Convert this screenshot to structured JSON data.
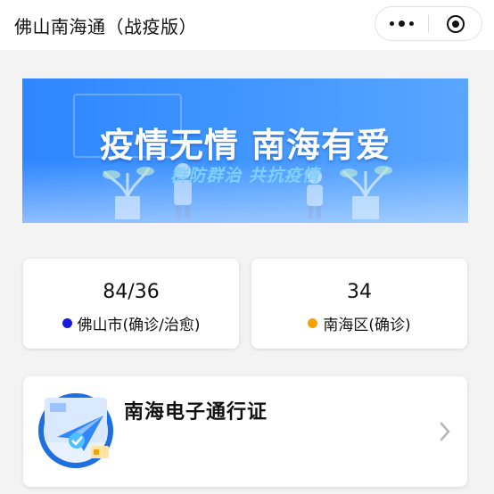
{
  "nav": {
    "title": "佛山南海通（战疫版）",
    "more_icon": "more-dots-icon",
    "close_icon": "target-icon"
  },
  "banner": {
    "title": "疫情无情 南海有爱",
    "subtitle": "群防群治 共抗疫情"
  },
  "stats": [
    {
      "value": "84/36",
      "label": "佛山市(确诊/治愈)",
      "dot_color": "#1a1adf"
    },
    {
      "value": "34",
      "label": "南海区(确诊)",
      "dot_color": "#f5a300"
    }
  ],
  "pass_card": {
    "title": "南海电子通行证",
    "icon": "paper-plane-icon",
    "arrow": "chevron-right-icon"
  }
}
